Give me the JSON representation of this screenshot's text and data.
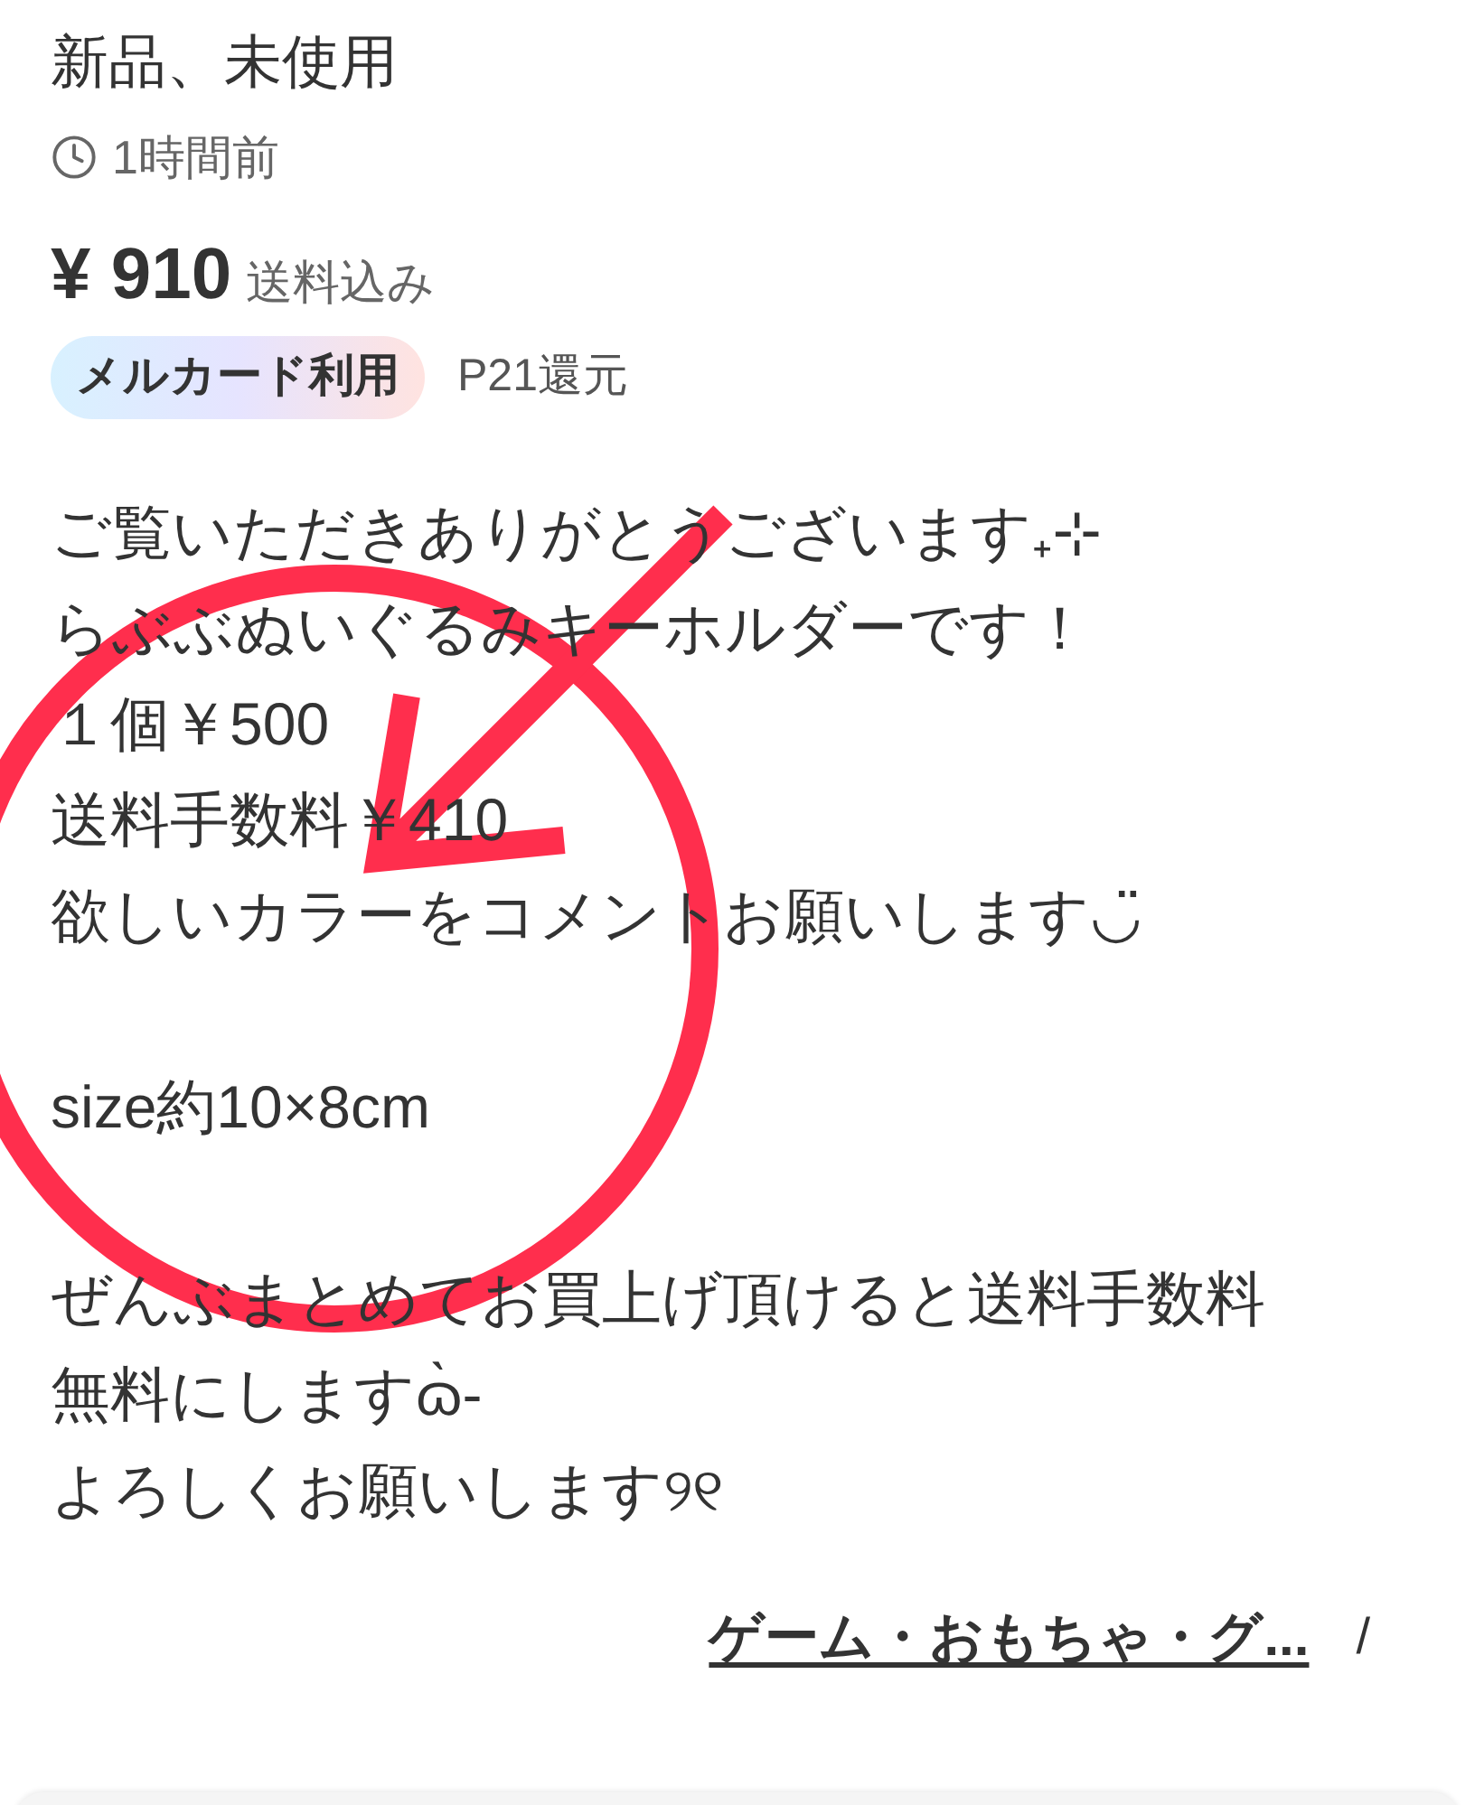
{
  "condition": "新品、未使用",
  "posted": "1時間前",
  "price": {
    "amount": "¥ 910",
    "note": "送料込み"
  },
  "badge": "メルカード利用",
  "points": "P21還元",
  "description": [
    [
      "ご覧いただきありがとうございます₊⊹",
      "らぶぶぬいぐるみキーホルダーです！",
      "１個￥500",
      "送料手数料￥410",
      "欲しいカラーをコメントお願いします◡̈"
    ],
    [
      "size約10×8cm"
    ],
    [
      "ぜんぶまとめてお買上げ頂けると送料手数料",
      "無料にしますɷ̀-",
      "よろしくお願いします୨୧"
    ]
  ],
  "breadcrumb": {
    "category": "ゲーム・おもちゃ・グ...",
    "separator": "/"
  }
}
